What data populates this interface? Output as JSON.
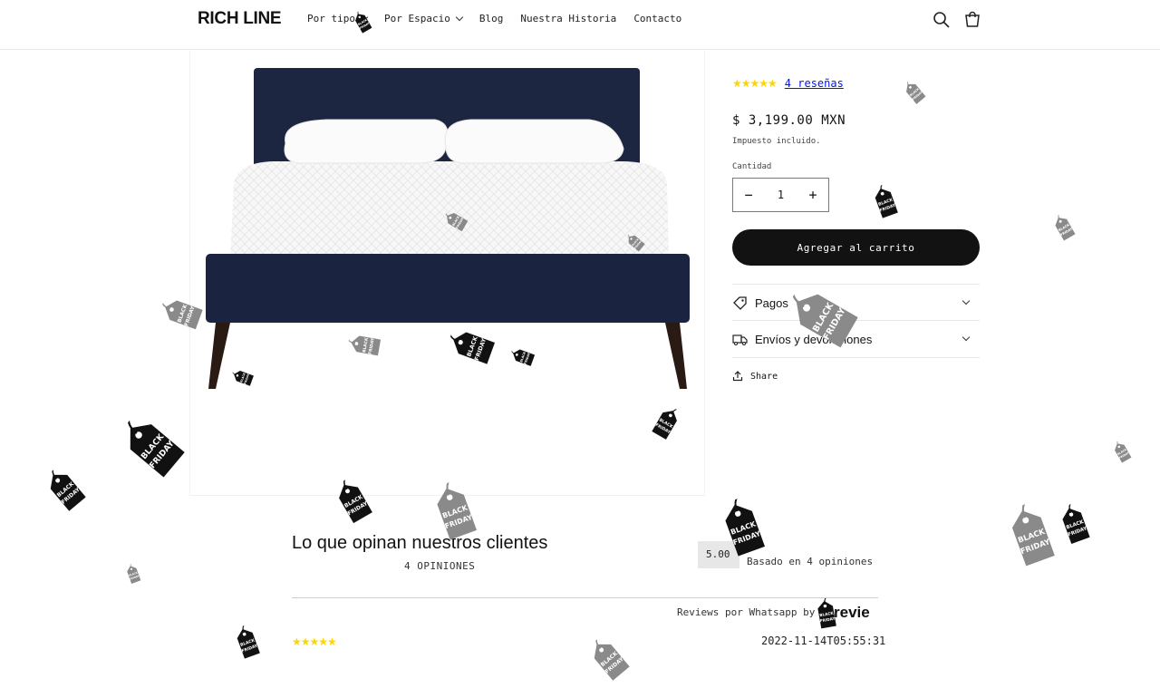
{
  "header": {
    "logo": "RICH LINE",
    "nav": [
      {
        "label": "Por tipo",
        "has_dropdown": true
      },
      {
        "label": "Por Espacio",
        "has_dropdown": true
      },
      {
        "label": "Blog",
        "has_dropdown": false
      },
      {
        "label": "Nuestra Historia",
        "has_dropdown": false
      },
      {
        "label": "Contacto",
        "has_dropdown": false
      }
    ],
    "icons": [
      "search-icon",
      "cart-icon"
    ]
  },
  "product": {
    "rating_stars": "★★★★★",
    "reviews_link": "4 reseñas",
    "price": "$ 3,199.00 MXN",
    "tax_note": "Impuesto incluido.",
    "quantity_label": "Cantidad",
    "quantity_value": "1",
    "decrease": "−",
    "increase": "+",
    "add_to_cart": "Agregar al carrito",
    "accordions": [
      {
        "label": "Pagos",
        "icon": "tag-icon"
      },
      {
        "label": "Envíos y devoluciones",
        "icon": "truck-icon"
      }
    ],
    "share": "Share"
  },
  "reviews": {
    "title": "Lo que opinan nuestros clientes",
    "count": "4 OPINIONES",
    "score": "5.00",
    "score_stars": "★★",
    "based_on": "Basado en 4 opiniones",
    "powered_by": "Reviews por Whatsapp by",
    "brand": "revie",
    "first_review": {
      "stars": "★★★★★",
      "date": "2022-11-14T05:55:31"
    }
  },
  "overlay": {
    "tag_text": "BLACK FRIDAY",
    "colors": {
      "dark": "#111111",
      "grey": "#8a8a8a"
    }
  },
  "colors": {
    "accent_star": "#ffd500",
    "link": "#0015ee",
    "button": "#121212"
  }
}
